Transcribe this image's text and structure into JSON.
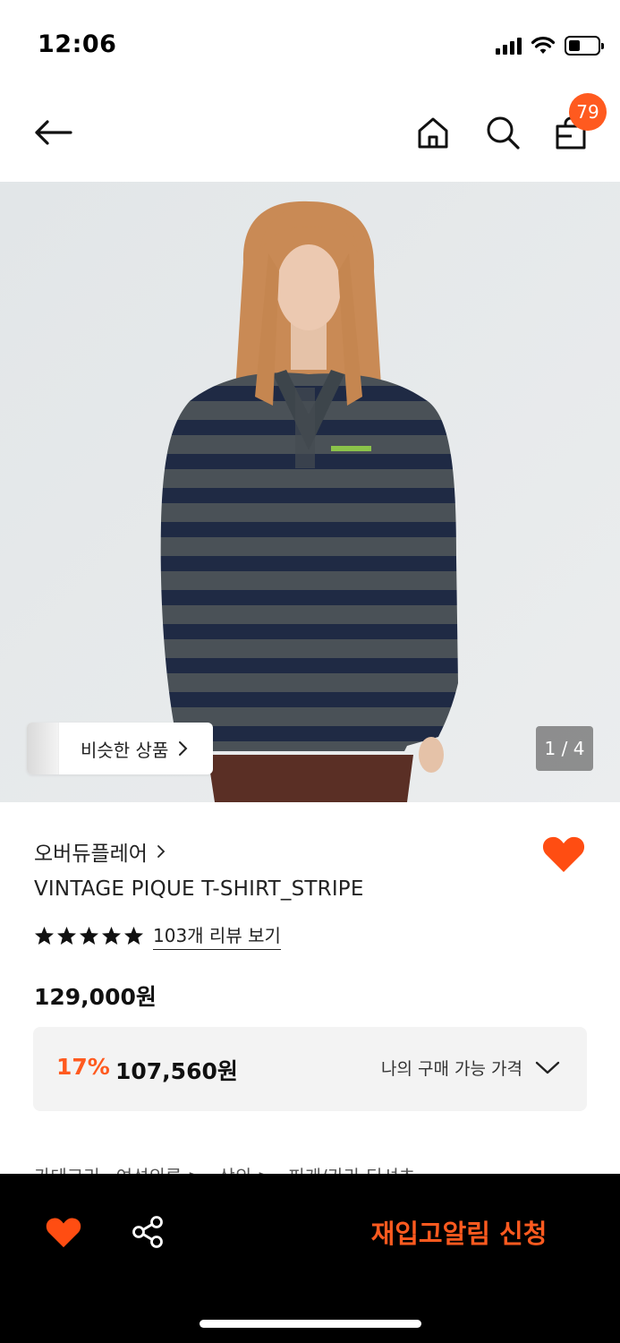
{
  "status_bar": {
    "time": "12:06",
    "battery_level": 0.4
  },
  "header": {
    "cart_count": "79",
    "icons": [
      "back-arrow-icon",
      "home-icon",
      "search-icon",
      "shopping-bag-icon"
    ]
  },
  "hero": {
    "similar_label": "비슷한 상품",
    "page_indicator": "1 / 4"
  },
  "product": {
    "brand": "오버듀플레어",
    "name": "VINTAGE PIQUE T-SHIRT_STRIPE",
    "rating": 5,
    "review_link": "103개 리뷰 보기",
    "original_price": "129,000원",
    "discount_rate": "17%",
    "sale_price": "107,560원",
    "my_price_label": "나의 구매 가능 가격",
    "wishlisted": true
  },
  "category_peek": [
    "카테고리",
    "여성의류 >",
    "상의 >",
    "피케/카라 티셔츠"
  ],
  "bottom_bar": {
    "restock_label": "재입고알림 신청"
  },
  "colors": {
    "accent": "#ff5a1f",
    "bottom_bar": "#000000"
  }
}
